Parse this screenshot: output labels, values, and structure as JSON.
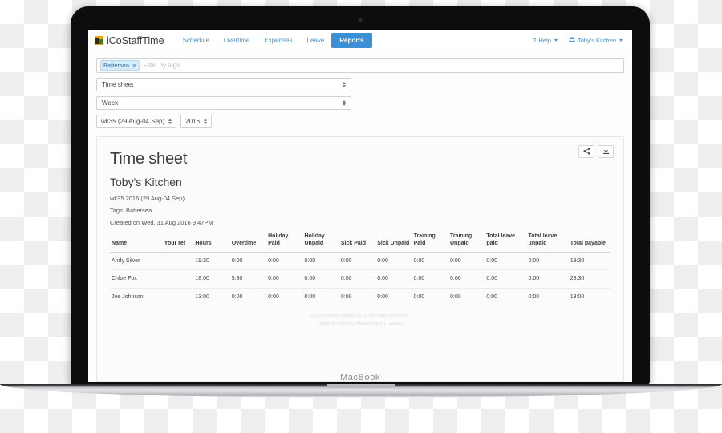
{
  "device": {
    "wordmark": "MacBook"
  },
  "navbar": {
    "brand": "iCoStaffTime",
    "tabs": [
      {
        "label": "Schedule",
        "active": false
      },
      {
        "label": "Overtime",
        "active": false
      },
      {
        "label": "Expenses",
        "active": false
      },
      {
        "label": "Leave",
        "active": false
      },
      {
        "label": "Reports",
        "active": true
      }
    ],
    "help_label": "Help",
    "account_label": "Toby's Kitchen"
  },
  "filters": {
    "tag_pill": "Battersea",
    "tag_pill_remove": "×",
    "tag_placeholder": "Filter by tags",
    "tag_value": "",
    "report_type": "Time sheet",
    "period_type": "Week",
    "week": "wk35 (29 Aug-04 Sep)",
    "year": "2016"
  },
  "report": {
    "actions": {
      "share": "share-icon",
      "download": "download-icon"
    },
    "title": "Time sheet",
    "subtitle": "Toby's Kitchen",
    "period": "wk35 2016 (29 Aug-04 Sep)",
    "tags": "Tags: Battersea",
    "created": "Created on Wed, 31 Aug 2016 9:47PM",
    "columns": [
      "Name",
      "Your ref",
      "Hours",
      "Overtime",
      "Holiday Paid",
      "Holiday Unpaid",
      "Sick Paid",
      "Sick Unpaid",
      "Training Paid",
      "Training Unpaid",
      "Total leave paid",
      "Total leave unpaid",
      "Total payable"
    ],
    "rows": [
      {
        "name": "Andy Silver",
        "your_ref": "",
        "hours": "19:30",
        "overtime": "0:00",
        "holiday_paid": "0:00",
        "holiday_unpaid": "0:00",
        "sick_paid": "0:00",
        "sick_unpaid": "0:00",
        "training_paid": "0:00",
        "training_unpaid": "0:00",
        "total_leave_paid": "0:00",
        "total_leave_unpaid": "0:00",
        "total_payable": "19:30"
      },
      {
        "name": "Chloe Fox",
        "your_ref": "",
        "hours": "18:00",
        "overtime": "5:30",
        "holiday_paid": "0:00",
        "holiday_unpaid": "0:00",
        "sick_paid": "0:00",
        "sick_unpaid": "0:00",
        "training_paid": "0:00",
        "training_unpaid": "0:00",
        "total_leave_paid": "0:00",
        "total_leave_unpaid": "0:00",
        "total_payable": "23:30"
      },
      {
        "name": "Joe Johnson",
        "your_ref": "",
        "hours": "13:00",
        "overtime": "0:00",
        "holiday_paid": "0:00",
        "holiday_unpaid": "0:00",
        "sick_paid": "0:00",
        "sick_unpaid": "0:00",
        "training_paid": "0:00",
        "training_unpaid": "0:00",
        "total_leave_paid": "0:00",
        "total_leave_unpaid": "0:00",
        "total_payable": "13:00"
      }
    ]
  },
  "footer": {
    "copyright": "© iCoSoftware Limited 2016. All Rights Reserved.",
    "links": [
      "Terms of Service",
      "Privacy Policy",
      "Cookies"
    ],
    "separator": " | "
  },
  "colors": {
    "accent": "#3b8fd4",
    "link": "#4a8fc9",
    "tag_bg": "#d6ecf8",
    "tag_text": "#2c6ea3",
    "brand_mark": "#e8a317"
  }
}
